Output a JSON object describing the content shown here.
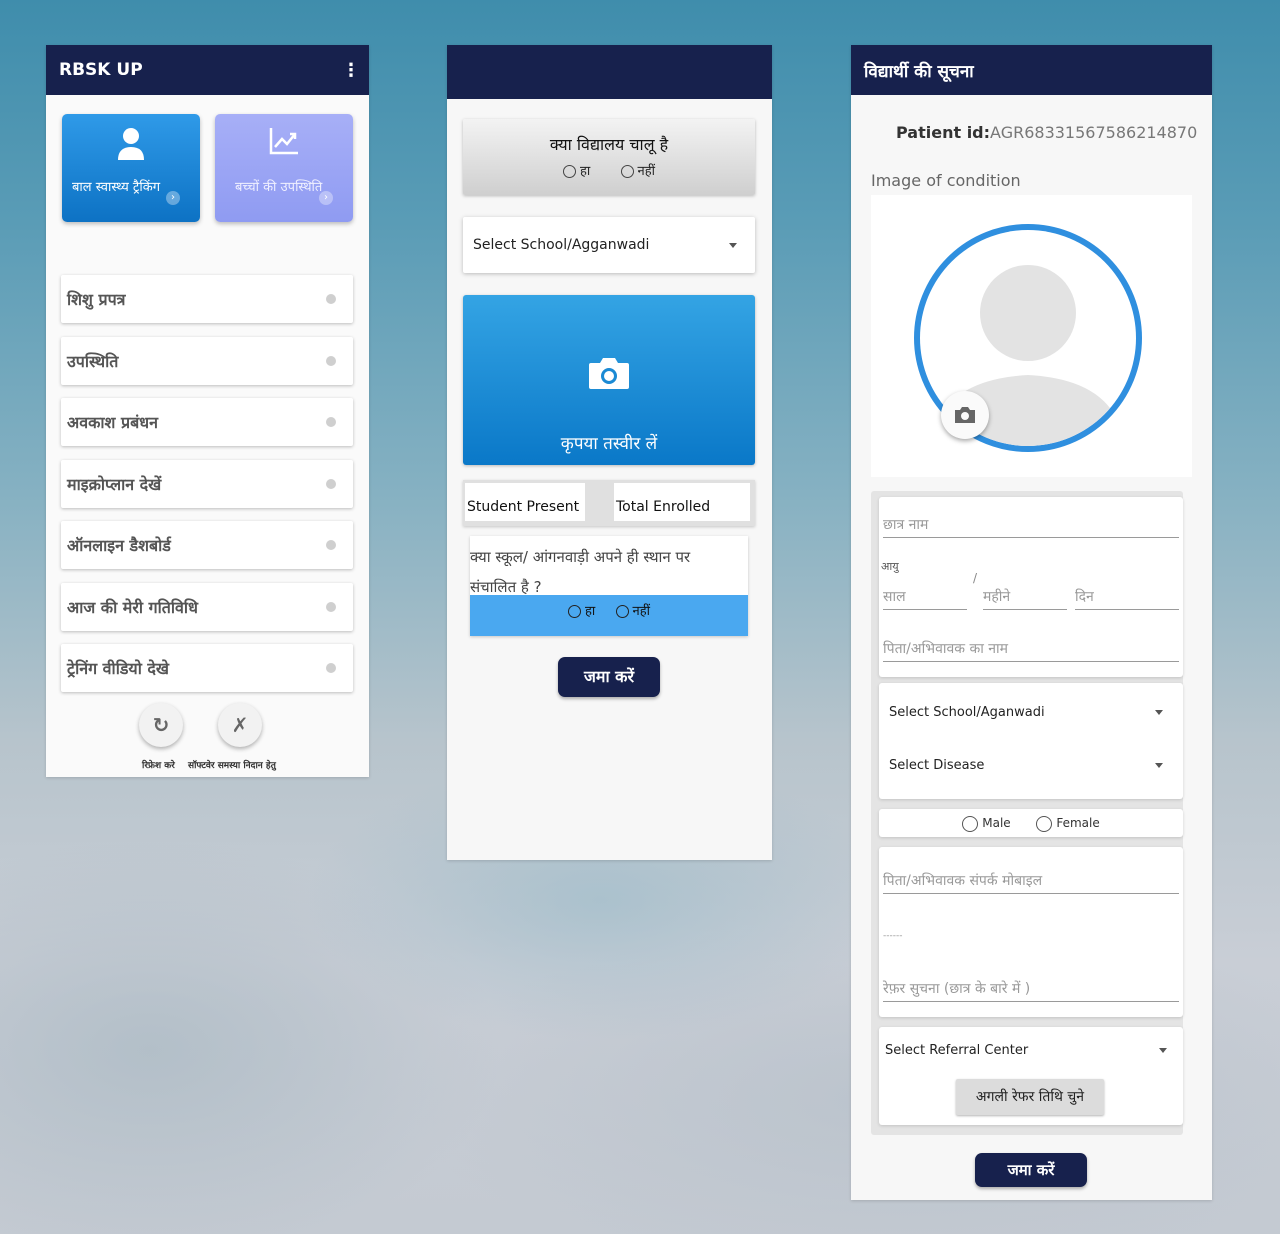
{
  "screen1": {
    "app_title": "RBSK UP",
    "menu_icon": "kebab-menu-icon",
    "cards": [
      {
        "label": "बाल स्वास्थ्य ट्रैकिंग",
        "icon": "user-icon",
        "color": "#1588d6"
      },
      {
        "label": "बच्चों की उपस्थिति",
        "icon": "trend-chart-icon",
        "color": "#9aa4f5"
      }
    ],
    "menu_items": [
      "शिशु प्रपत्र",
      "उपस्थिति",
      "अवकाश प्रबंधन",
      "माइक्रोप्लान देखें",
      "ऑनलाइन डैशबोर्ड",
      "आज की मेरी गतिविधि",
      "ट्रेनिंग वीडियो देखे"
    ],
    "refresh_label": "रिफ्रेश करे",
    "troubleshoot_label": "सॉफ्टवेर समस्या निदान हेतु"
  },
  "screen2": {
    "school_open_question": "क्या विद्यालय चालू है",
    "yes": "हा",
    "no": "नहीं",
    "select_school": "Select School/Agganwadi",
    "camera_label": "कृपया तस्वीर लें",
    "student_present": "Student Present",
    "total_enrolled": "Total Enrolled",
    "same_place_question": "क्या स्कूल/ आंगनवाड़ी अपने ही स्थान पर संचालित है ?",
    "submit": "जमा करें"
  },
  "screen3": {
    "title": "विद्यार्थी की सूचना",
    "patient_id_label": "Patient id:",
    "patient_id_value": "AGR68331567586214870",
    "image_label": "Image of condition",
    "student_name_placeholder": "छात्र नाम",
    "age_label": "आयु",
    "age_sep": "/",
    "year_placeholder": "साल",
    "month_placeholder": "महीने",
    "day_placeholder": "दिन",
    "guardian_placeholder": "पिता/अभिवावक का नाम",
    "select_school": "Select School/Aganwadi",
    "select_disease": "Select Disease",
    "male": "Male",
    "female": "Female",
    "mobile_placeholder": "पिता/अभिवावक संपर्क मोबाइल",
    "small_label": "------",
    "refer_info_placeholder": "रेफ़र सुचना (छात्र के बारे में )",
    "select_referral": "Select Referral Center",
    "next_refer_button": "अगली रेफर तिथि चुने",
    "submit": "जमा करें",
    "accent": "#2f8fdf"
  }
}
